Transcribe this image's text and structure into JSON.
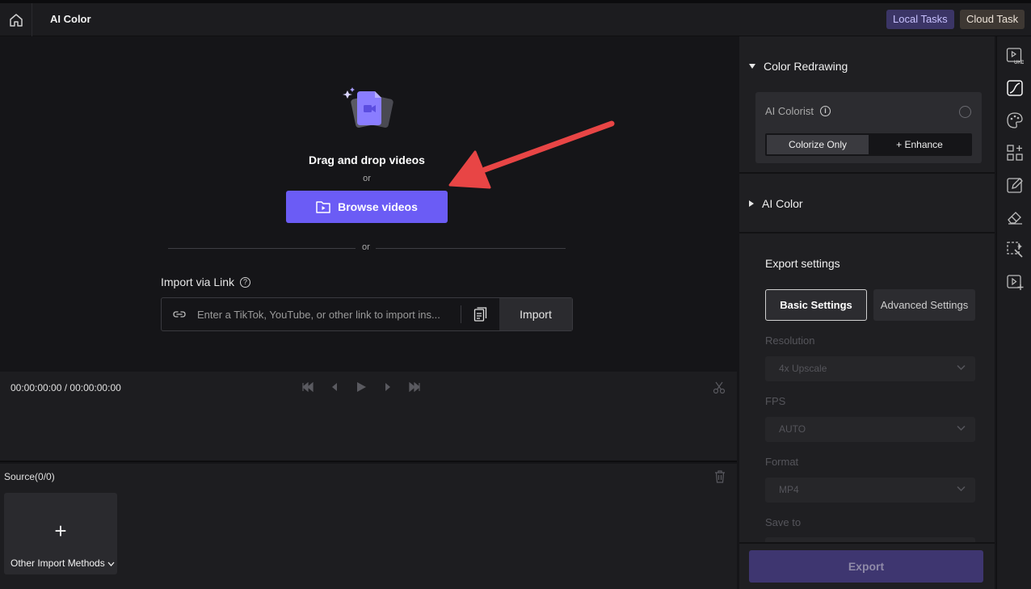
{
  "header": {
    "title": "AI Color",
    "local_tasks": "Local Tasks",
    "cloud_task": "Cloud Task"
  },
  "upload": {
    "drag_text": "Drag and drop videos",
    "or_1": "or",
    "browse_label": "Browse videos",
    "or_2": "or",
    "import_via_link": "Import via Link",
    "link_placeholder": "Enter a TikTok, YouTube, or other link to import ins...",
    "import_label": "Import"
  },
  "timeline": {
    "timecode": "00:00:00:00 / 00:00:00:00"
  },
  "source": {
    "title": "Source(0/0)",
    "add_symbol": "+",
    "other_import": "Other Import Methods"
  },
  "panel": {
    "color_redrawing": "Color Redrawing",
    "ai_colorist": "AI Colorist",
    "colorize_only": "Colorize Only",
    "enhance": "+ Enhance",
    "ai_color": "AI Color",
    "export_settings": "Export settings",
    "basic_settings": "Basic Settings",
    "advanced_settings": "Advanced Settings",
    "resolution_label": "Resolution",
    "resolution_value": "4x Upscale",
    "fps_label": "FPS",
    "fps_value": "AUTO",
    "format_label": "Format",
    "format_value": "MP4",
    "save_to_label": "Save to",
    "export": "Export"
  },
  "tools": [
    "uhd-video-icon",
    "color-curve-icon",
    "ai-color-icon",
    "add-apps-icon",
    "edit-icon",
    "eraser-icon",
    "magic-select-icon",
    "video-add-icon"
  ],
  "colors": {
    "accent": "#6b5cf5",
    "export_disabled": "#3e3670",
    "annotation_arrow": "#e84545"
  }
}
